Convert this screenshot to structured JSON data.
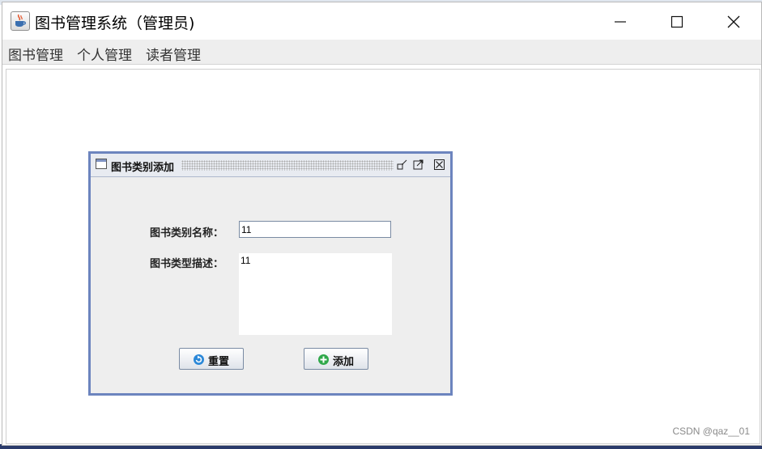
{
  "window": {
    "title": "图书管理系统（管理员)"
  },
  "menubar": {
    "items": [
      {
        "label": "图书管理"
      },
      {
        "label": "个人管理"
      },
      {
        "label": "读者管理"
      }
    ]
  },
  "dialog": {
    "title": "图书类别添加",
    "name_label": "图书类别名称：",
    "name_value": "11",
    "desc_label": "图书类型描述：",
    "desc_value": "11",
    "reset_label": "重置",
    "add_label": "添加"
  },
  "icons": {
    "app": "java-cup-icon",
    "minimize": "minimize-icon",
    "maximize": "maximize-icon",
    "close": "close-icon",
    "frame": "window-frame-icon",
    "iconify": "iconify-icon",
    "frame_maximize": "frame-maximize-icon",
    "frame_close": "frame-close-icon",
    "reset": "reset-icon",
    "add": "add-icon"
  },
  "colors": {
    "frame_border": "#6c84be",
    "add_icon": "#2fa84a",
    "reset_icon": "#2b88d8"
  },
  "watermark": "CSDN @qaz__01"
}
